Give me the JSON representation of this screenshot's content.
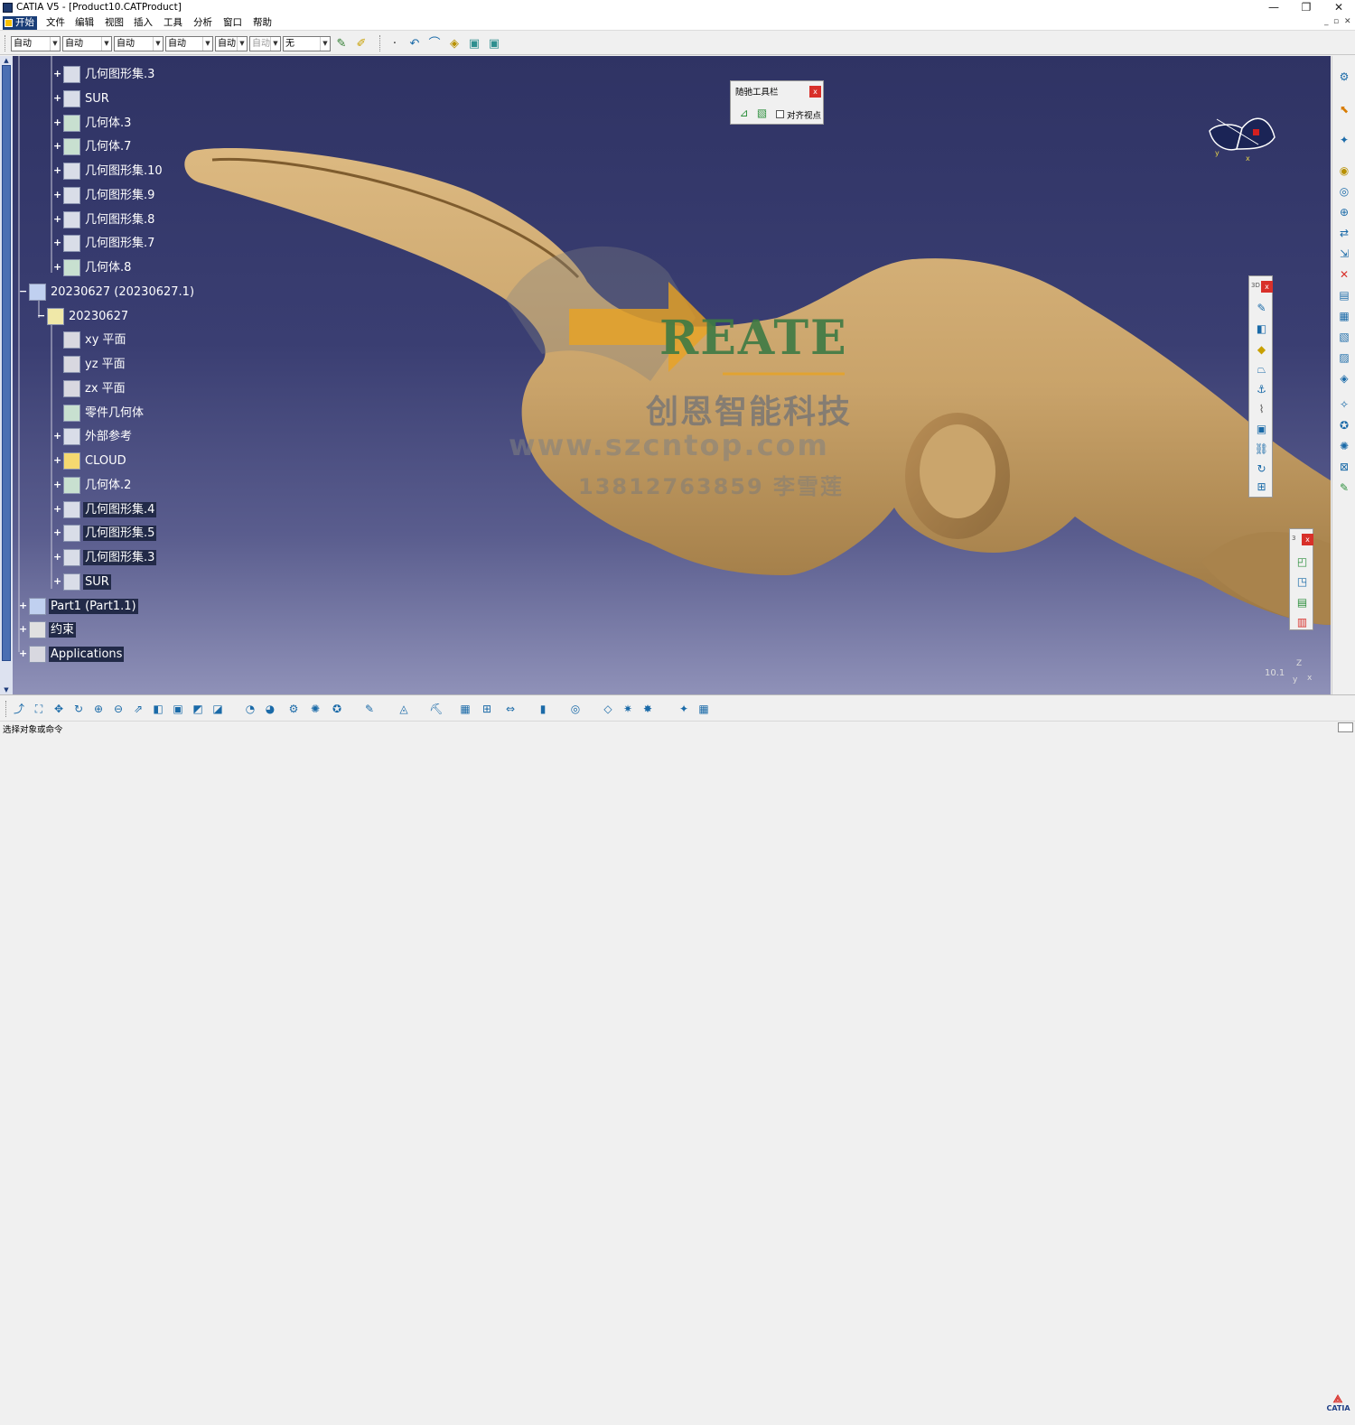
{
  "window": {
    "title": "CATIA V5 - [Product10.CATProduct]",
    "min_glyph": "—",
    "max_glyph": "❐",
    "close_glyph": "✕",
    "mdi_min": "_",
    "mdi_max": "▫",
    "mdi_close": "✕"
  },
  "menu": {
    "items": [
      "开始",
      "文件",
      "编辑",
      "视图",
      "插入",
      "工具",
      "分析",
      "窗口",
      "帮助"
    ]
  },
  "toolbar": {
    "combos": [
      {
        "value": "自动",
        "enabled": true
      },
      {
        "value": "自动",
        "enabled": true
      },
      {
        "value": "自动",
        "enabled": true
      },
      {
        "value": "自动",
        "enabled": true
      },
      {
        "value": "自动",
        "enabled": true
      },
      {
        "value": "自动",
        "enabled": false
      },
      {
        "value": "无",
        "enabled": true
      }
    ],
    "icons": [
      "paintbrush-icon",
      "format-painter-icon",
      "point-icon",
      "curve-icon",
      "surface-icon",
      "material-icon",
      "view-icon",
      "view-2-icon"
    ]
  },
  "tree": {
    "nodes": [
      {
        "label": "几何图形集.3",
        "level": 2,
        "icon": "geom-set-icon",
        "expander": "+",
        "highlight": false
      },
      {
        "label": "SUR",
        "level": 2,
        "icon": "geom-set-icon",
        "expander": "+",
        "highlight": false
      },
      {
        "label": "几何体.3",
        "level": 2,
        "icon": "body-icon",
        "expander": "+",
        "highlight": false
      },
      {
        "label": "几何体.7",
        "level": 2,
        "icon": "body-icon",
        "expander": "+",
        "highlight": false
      },
      {
        "label": "几何图形集.10",
        "level": 2,
        "icon": "geom-set-icon",
        "expander": "+",
        "highlight": false
      },
      {
        "label": "几何图形集.9",
        "level": 2,
        "icon": "geom-set-icon",
        "expander": "+",
        "highlight": false
      },
      {
        "label": "几何图形集.8",
        "level": 2,
        "icon": "geom-set-icon",
        "expander": "+",
        "highlight": false
      },
      {
        "label": "几何图形集.7",
        "level": 2,
        "icon": "geom-set-icon",
        "expander": "+",
        "highlight": false
      },
      {
        "label": "几何体.8",
        "level": 2,
        "icon": "body-icon",
        "expander": "+",
        "highlight": false
      },
      {
        "label": "20230627 (20230627.1)",
        "level": 0,
        "icon": "product-icon",
        "expander": "−",
        "highlight": false
      },
      {
        "label": "20230627",
        "level": 1,
        "icon": "part-icon",
        "expander": "−",
        "highlight": false
      },
      {
        "label": "xy 平面",
        "level": 2,
        "icon": "plane-icon",
        "expander": "",
        "highlight": false
      },
      {
        "label": "yz 平面",
        "level": 2,
        "icon": "plane-icon",
        "expander": "",
        "highlight": false
      },
      {
        "label": "zx 平面",
        "level": 2,
        "icon": "plane-icon",
        "expander": "",
        "highlight": false
      },
      {
        "label": "零件几何体",
        "level": 2,
        "icon": "body-icon",
        "expander": "",
        "highlight": false
      },
      {
        "label": "外部参考",
        "level": 2,
        "icon": "geom-set-icon",
        "expander": "+",
        "highlight": false
      },
      {
        "label": "CLOUD",
        "level": 2,
        "icon": "cloud-icon",
        "expander": "+",
        "highlight": false
      },
      {
        "label": "几何体.2",
        "level": 2,
        "icon": "body-icon",
        "expander": "+",
        "highlight": false
      },
      {
        "label": "几何图形集.4",
        "level": 2,
        "icon": "geom-set-icon",
        "expander": "+",
        "highlight": true
      },
      {
        "label": "几何图形集.5",
        "level": 2,
        "icon": "geom-set-icon",
        "expander": "+",
        "highlight": true
      },
      {
        "label": "几何图形集.3",
        "level": 2,
        "icon": "geom-set-icon",
        "expander": "+",
        "highlight": true
      },
      {
        "label": "SUR",
        "level": 2,
        "icon": "geom-set-icon",
        "expander": "+",
        "highlight": true
      },
      {
        "label": "Part1 (Part1.1)",
        "level": 0,
        "icon": "product-icon",
        "expander": "+",
        "highlight": true
      },
      {
        "label": "约束",
        "level": 0,
        "icon": "constraints-icon",
        "expander": "+",
        "highlight": true
      },
      {
        "label": "Applications",
        "level": 0,
        "icon": "applications-icon",
        "expander": "+",
        "highlight": true
      }
    ]
  },
  "sub_toolbar": {
    "title": "随驰工具栏",
    "close": "x",
    "align_label": "对齐视点",
    "align_checked": false
  },
  "compass": {
    "axis_y": "y",
    "axis_x": "x"
  },
  "viewport_corner": {
    "zoom": "10.1",
    "axis_z": "Z",
    "axis_y": "y",
    "axis_x": "x"
  },
  "watermark": {
    "brand": "REATE",
    "company": "创恩智能科技",
    "url": "www.szcntop.com",
    "phone": "13812763859 李雪莲"
  },
  "vtool1": {
    "caption": "3D",
    "close": "x"
  },
  "vtool2": {
    "caption": "3",
    "close": "x"
  },
  "bottom_toolbar": {
    "icons": [
      "fly-mode-icon",
      "fit-all-icon",
      "pan-icon",
      "rotate-icon",
      "zoom-in-icon",
      "zoom-out-icon",
      "normal-view-icon",
      "iso-view-icon",
      "render-style-icon",
      "hide-show-icon",
      "swap-visible-icon",
      "catalog-icon",
      "catalog-2-icon",
      "macro-icon",
      "tools-icon",
      "tools-2-icon",
      "knowledge-icon",
      "measure-icon",
      "camera-icon",
      "print-icon",
      "explode-icon",
      "constraint-icon",
      "battery-icon",
      "update-icon",
      "sheet-icon",
      "analysis-icon",
      "analysis-2-icon",
      "analysis-3-icon",
      "grid-icon"
    ]
  },
  "logo": {
    "text": "CATIA",
    "mark": "⟁"
  },
  "status": {
    "text": "选择对象或命令"
  },
  "colors": {
    "background_top": "#2f3364",
    "background_bottom": "#8f91b8",
    "model": "#c9a36a",
    "highlight": "#222a48",
    "start_menu": "#1a3e78"
  }
}
